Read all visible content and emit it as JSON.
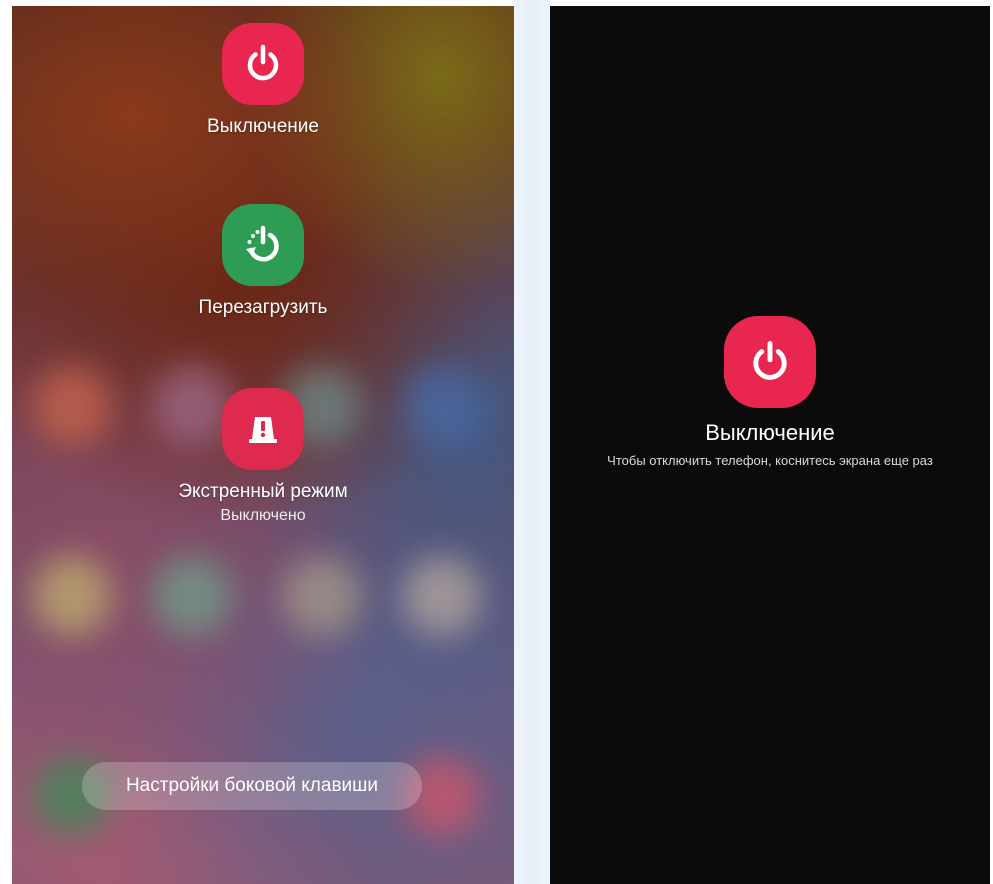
{
  "power_menu": {
    "power_off_label": "Выключение",
    "restart_label": "Перезагрузить",
    "emergency_label": "Экстренный режим",
    "emergency_status": "Выключено",
    "side_key_settings_label": "Настройки боковой клавиши",
    "icons": {
      "power_off": "power-icon",
      "restart": "restart-icon",
      "emergency": "emergency-mode-icon"
    }
  },
  "confirm_screen": {
    "title": "Выключение",
    "hint": "Чтобы отключить телефон, коснитесь экрана еще раз",
    "icon": "power-icon"
  },
  "colors": {
    "power_red": "#e8264f",
    "restart_green": "#2f9c55",
    "emergency_red": "#dd2a4e",
    "confirm_background": "#0b0b0c"
  }
}
